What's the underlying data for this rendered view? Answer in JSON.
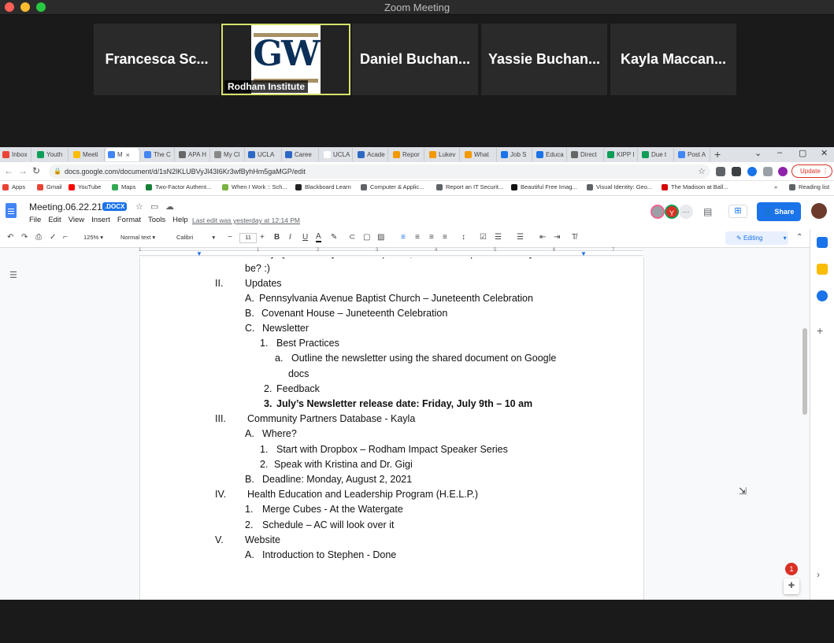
{
  "zoom": {
    "title": "Zoom Meeting",
    "participants": [
      {
        "name": "Francesca Sc..."
      },
      {
        "name": "Rodham Institute",
        "logo_text": "GW"
      },
      {
        "name": "Daniel Buchan..."
      },
      {
        "name": "Yassie Buchan..."
      },
      {
        "name": "Kayla Maccan..."
      }
    ]
  },
  "browser": {
    "tabs": [
      {
        "label": "Inbox",
        "color": "#ea4335"
      },
      {
        "label": "Youth",
        "color": "#0f9d58"
      },
      {
        "label": "Meeti",
        "color": "#fbbc04"
      },
      {
        "label": "M",
        "color": "#4285f4"
      },
      {
        "label": "The C",
        "color": "#4285f4"
      },
      {
        "label": "APA H",
        "color": "#666666"
      },
      {
        "label": "My Cl",
        "color": "#888888"
      },
      {
        "label": "UCLA",
        "color": "#2d68c4"
      },
      {
        "label": "Caree",
        "color": "#2d68c4"
      },
      {
        "label": "UCLA",
        "color": "#ffffff"
      },
      {
        "label": "Acade",
        "color": "#2d68c4"
      },
      {
        "label": "Repor",
        "color": "#f29900"
      },
      {
        "label": "Lukev",
        "color": "#f29900"
      },
      {
        "label": "What",
        "color": "#f29900"
      },
      {
        "label": "Job S",
        "color": "#1a73e8"
      },
      {
        "label": "Educa",
        "color": "#1a73e8"
      },
      {
        "label": "Direct",
        "color": "#666666"
      },
      {
        "label": "KIPP I",
        "color": "#0f9d58"
      },
      {
        "label": "Due t",
        "color": "#0f9d58"
      },
      {
        "label": "Post A",
        "color": "#4285f4"
      }
    ],
    "url": "docs.google.com/document/d/1sN2lKLUBVyJl43I6Kr3wfByhHm5gaMGP/edit",
    "update_label": "Update",
    "bookmarks": [
      {
        "label": "Apps",
        "color": "#ea4335"
      },
      {
        "label": "Gmail",
        "color": "#ea4335"
      },
      {
        "label": "YouTube",
        "color": "#ff0000"
      },
      {
        "label": "Maps",
        "color": "#34a853"
      },
      {
        "label": "Two-Factor Authent...",
        "color": "#188038"
      },
      {
        "label": "When I Work :: Sch...",
        "color": "#7cb342"
      },
      {
        "label": "Blackboard Learn",
        "color": "#222222"
      },
      {
        "label": "Computer & Applic...",
        "color": "#5f6368"
      },
      {
        "label": "Report an IT Securit...",
        "color": "#5f6368"
      },
      {
        "label": "Beautiful Free Imag...",
        "color": "#111111"
      },
      {
        "label": "Visual Identity: Geo...",
        "color": "#5f6368"
      },
      {
        "label": "The Madison at Ball...",
        "color": "#d50000"
      }
    ],
    "more_label": "»",
    "reading_list": "Reading list"
  },
  "docs": {
    "title": "Meeting.06.22.21",
    "badge": ".DOCX",
    "menus": [
      "File",
      "Edit",
      "View",
      "Insert",
      "Format",
      "Tools",
      "Help"
    ],
    "last_edit": "Last edit was yesterday at 12:14 PM",
    "share_label": "Share",
    "avatar_letter": "Y",
    "toolbar": {
      "zoom": "125%",
      "style": "Normal text",
      "font": "Calibri",
      "font_size": "11",
      "mode": "Editing"
    },
    "ruler_numbers": [
      "1",
      "1",
      "2",
      "3",
      "4",
      "5",
      "6",
      "7"
    ],
    "notification_count": "1",
    "lines": [
      {
        "num": "",
        "text": "-Funny Question:  If you were a potato, what kind of potato would you",
        "bold": false
      },
      {
        "num": "",
        "text": "be? :)",
        "bold": false
      },
      {
        "num": "II.",
        "text": "Updates",
        "bold": false
      },
      {
        "num": "A.",
        "text": "Pennsylvania Avenue Baptist Church – Juneteenth Celebration",
        "bold": false
      },
      {
        "num": "B.",
        "text": "Covenant House – Juneteenth Celebration",
        "bold": false
      },
      {
        "num": "C.",
        "text": "Newsletter",
        "bold": false
      },
      {
        "num": "1.",
        "text": "Best Practices",
        "bold": false
      },
      {
        "num": "a.",
        "text": "Outline the newsletter using the shared document on Google",
        "bold": false
      },
      {
        "num": "",
        "text": "docs",
        "bold": false
      },
      {
        "num": "2.",
        "text": "Feedback",
        "bold": false
      },
      {
        "num": "3.",
        "text": "July’s Newsletter release date:  Friday, July 9th – 10 am",
        "bold": true
      },
      {
        "num": "III.",
        "text": "Community Partners Database - Kayla",
        "bold": false
      },
      {
        "num": "A.",
        "text": "Where?",
        "bold": false
      },
      {
        "num": "1.",
        "text": "Start with Dropbox – Rodham Impact Speaker Series",
        "bold": false
      },
      {
        "num": "2.",
        "text": "Speak with Kristina and Dr. Gigi",
        "bold": false
      },
      {
        "num": "B.",
        "text": "Deadline:  Monday, August 2, 2021",
        "bold": false
      },
      {
        "num": "IV.",
        "text": "Health Education and Leadership Program (H.E.L.P.)",
        "bold": false
      },
      {
        "num": "1.",
        "text": "Merge Cubes - At the Watergate",
        "bold": false
      },
      {
        "num": "2.",
        "text": "Schedule – AC will look over it",
        "bold": false
      },
      {
        "num": "V.",
        "text": "Website",
        "bold": false
      },
      {
        "num": "A.",
        "text": "Introduction to Stephen - Done",
        "bold": false
      }
    ]
  }
}
